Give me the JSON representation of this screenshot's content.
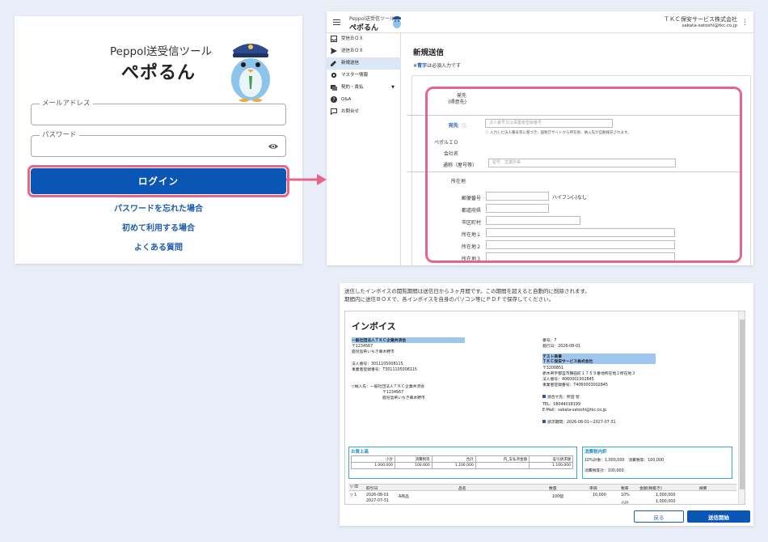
{
  "login": {
    "subtitle": "Peppol送受信ツール",
    "app_title": "ぺポるん",
    "email_label": "メールアドレス",
    "password_label": "パスワード",
    "login_button": "ログイン",
    "forgot_link": "パスワードを忘れた場合",
    "first_time_link": "初めて利用する場合",
    "faq_link": "よくある質問"
  },
  "app": {
    "subtitle": "Peppol送受信ツール",
    "title": "ぺポるん",
    "company": "ＴＫＣ保安サービス株式会社",
    "user_email": "sakata-satoshi@tkc.co.jp"
  },
  "sidebar": {
    "items": [
      {
        "label": "受信ＢＯＸ",
        "icon": "inbox-icon"
      },
      {
        "label": "送信ＢＯＸ",
        "icon": "send-icon"
      },
      {
        "label": "新規送信",
        "icon": "pencil-icon"
      },
      {
        "label": "マスター情報",
        "icon": "gear-icon"
      },
      {
        "label": "契約・責払",
        "icon": "contract-icon"
      },
      {
        "label": "Q&A",
        "icon": "help-icon"
      },
      {
        "label": "お問合せ",
        "icon": "chat-icon"
      }
    ]
  },
  "new_send": {
    "title": "新規送信",
    "required_prefix": "※",
    "required_blue": "青字",
    "required_suffix": "は必須入力です",
    "recipient_label": "発先\n(得意先)",
    "address_to_label": "宛先",
    "address_to_placeholder": "法人番号又は事業者登録番号",
    "address_to_note": "入力した法人番号等に基づき、国税庁サイトから所在地、納入先が自動報充されます。",
    "peppol_id_label": "ペポルＩＤ",
    "company_name_label": "会社名",
    "trade_name_label": "通称（屋号等）",
    "trade_name_placeholder": "屋号、営業所等",
    "location_label": "所在地",
    "postal_label": "郵便番号",
    "postal_hint": "ハイフン(-)なし",
    "prefecture_label": "都道府県",
    "city_label": "市区町村",
    "address1_label": "所在地１",
    "address2_label": "所在地２",
    "address3_label": "所在地３"
  },
  "invoice": {
    "notice_line1": "送信したインボイスの閲覧期間は送信日から３ヶ月間です。この期間を超えると自動的に削除されます。",
    "notice_line2": "期間内に送信ＢＯＸで、各インボイスを自身のパソコン等にＰＤＦで保存してください。",
    "heading": "インボイス",
    "buyer_name": "一般社団法人ＴＫＣ企業共済会",
    "buyer_postal": "〒1234567",
    "buyer_address": "鹿児島県いちき串木野市",
    "corp_no": "法人番号：3011105008115",
    "reg_no": "事業者登録番号：T3011105008115",
    "delivery_label": "▽納入先：一般社団法人ＴＫＣ企業共済会",
    "delivery_postal": "〒1234567",
    "delivery_address": "鹿児島県いちき串木野市",
    "number": "番号：7",
    "issue_date": "発行日：2026-08-01",
    "seller_name1": "テスト商事",
    "seller_name2": "ＴＫＣ保安サービス株式会社",
    "seller_postal": "〒3200851",
    "seller_address": "栃木県宇都宮市鶴田町１７５９番地所在地２所在地３",
    "seller_corp_no": "法人番号：4060001002845",
    "seller_reg_no": "事業者登録番号：T4060001002845",
    "contact_label": "請合せ先：所田 智",
    "tel": "TEL：08044018199",
    "email": "E-Mail：sakata-satoshi@tkc.co.jp",
    "period": "請求期間：2026-08-01～2027-07-31",
    "sales_title": "お買上高",
    "sales_headers": [
      "小計",
      "消費税等",
      "合計",
      "内_支払済金額",
      "差引請求額"
    ],
    "sales_values": [
      "1,000,000",
      "100,000",
      "1,100,000",
      "",
      "1,100,000"
    ],
    "tax_title": "消費税内訳",
    "tax_line1": "10%対象：1,000,000　消費税等：100,000",
    "tax_line2": "消費税等計：100,000",
    "line_headers": [
      "▽ ID",
      "取引日",
      "品名",
      "数量",
      "単価",
      "税率",
      "金額(税抜き)",
      "摘要"
    ],
    "line1": [
      "▽ 1",
      "2026-08-01",
      "A商品",
      "100個",
      "10,000",
      "10%",
      "1,000,000",
      ""
    ],
    "line1_date2": "2027-07-31",
    "line1_sub_rate": "小計",
    "line1_sub_amount": "1,000,000",
    "back_button": "戻る",
    "send_button": "送信開始"
  }
}
